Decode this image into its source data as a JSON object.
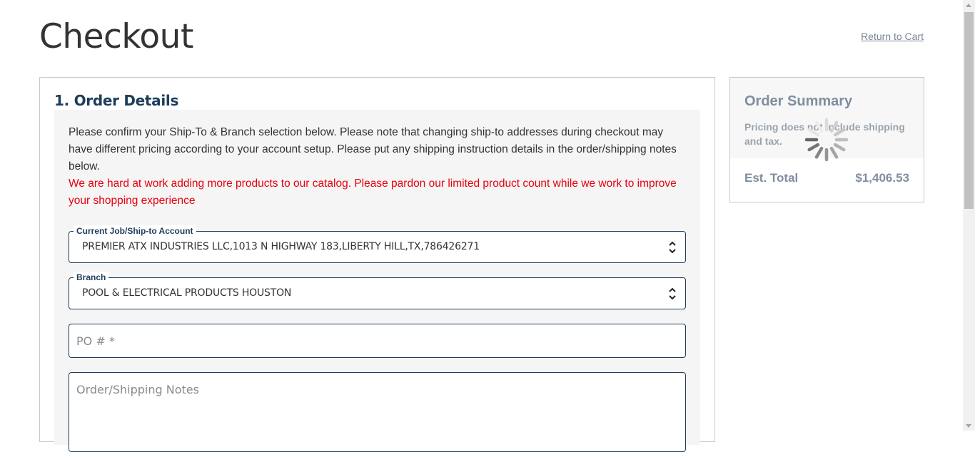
{
  "page": {
    "title": "Checkout",
    "return_link": "Return to Cart"
  },
  "order_details": {
    "title": "1. Order Details",
    "info": "Please confirm your Ship-To & Branch selection below. Please note that changing ship-to addresses during checkout may have different pricing according to your account setup. Please put any shipping instruction details in the order/shipping notes below.",
    "warning": "We are hard at work adding more products to our catalog. Please pardon our limited product count while we work to improve your shopping experience",
    "ship_to": {
      "label": "Current Job/Ship-to Account",
      "value": "PREMIER ATX INDUSTRIES LLC,1013 N HIGHWAY 183,LIBERTY HILL,TX,786426271"
    },
    "branch": {
      "label": "Branch",
      "value": "POOL & ELECTRICAL PRODUCTS HOUSTON"
    },
    "po": {
      "placeholder": "PO # *",
      "value": ""
    },
    "notes": {
      "placeholder": "Order/Shipping Notes",
      "value": ""
    }
  },
  "summary": {
    "title": "Order Summary",
    "note": "Pricing does not include shipping and tax.",
    "total_label": "Est. Total",
    "total_value": "$1,406.53"
  },
  "icons": {
    "spinner": "loading-spinner-icon",
    "select_arrows": "chevron-up-down-icon"
  },
  "colors": {
    "heading": "#1e3d5c",
    "warning": "#e8000c",
    "summary_text": "#7f8ea0"
  }
}
